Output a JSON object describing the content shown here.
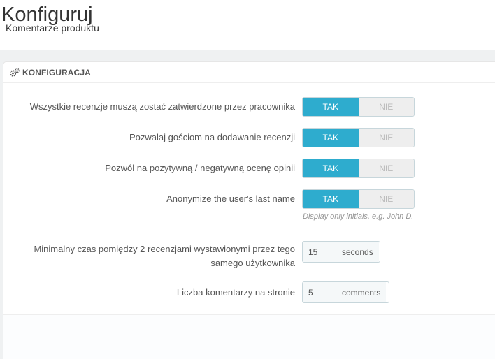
{
  "header": {
    "title": "Konfiguruj",
    "subtitle": "Komentarze produktu"
  },
  "panel": {
    "heading": "KONFIGURACJA",
    "heading_icon": "cogs-icon"
  },
  "settings": [
    {
      "label": "Wszystkie recenzje muszą zostać zatwierdzone przez pracownika",
      "on_label": "TAK",
      "off_label": "NIE",
      "value": "TAK"
    },
    {
      "label": "Pozwalaj gościom na dodawanie recenzji",
      "on_label": "TAK",
      "off_label": "NIE",
      "value": "TAK"
    },
    {
      "label": "Pozwól na pozytywną / negatywną ocenę opinii",
      "on_label": "TAK",
      "off_label": "NIE",
      "value": "TAK"
    },
    {
      "label": "Anonymize the user's last name",
      "on_label": "TAK",
      "off_label": "NIE",
      "value": "TAK",
      "help": "Display only initials, e.g. John D."
    }
  ],
  "min_time": {
    "label_line1": "Minimalny czas pomiędzy 2 recenzjami wystawionymi przez tego",
    "label_line2": "samego użytkownika",
    "value": "15",
    "unit": "seconds"
  },
  "per_page": {
    "label": "Liczba komentarzy na stronie",
    "value": "5",
    "unit": "comments"
  },
  "colors": {
    "accent": "#2eacce",
    "background": "#eff1f2"
  }
}
